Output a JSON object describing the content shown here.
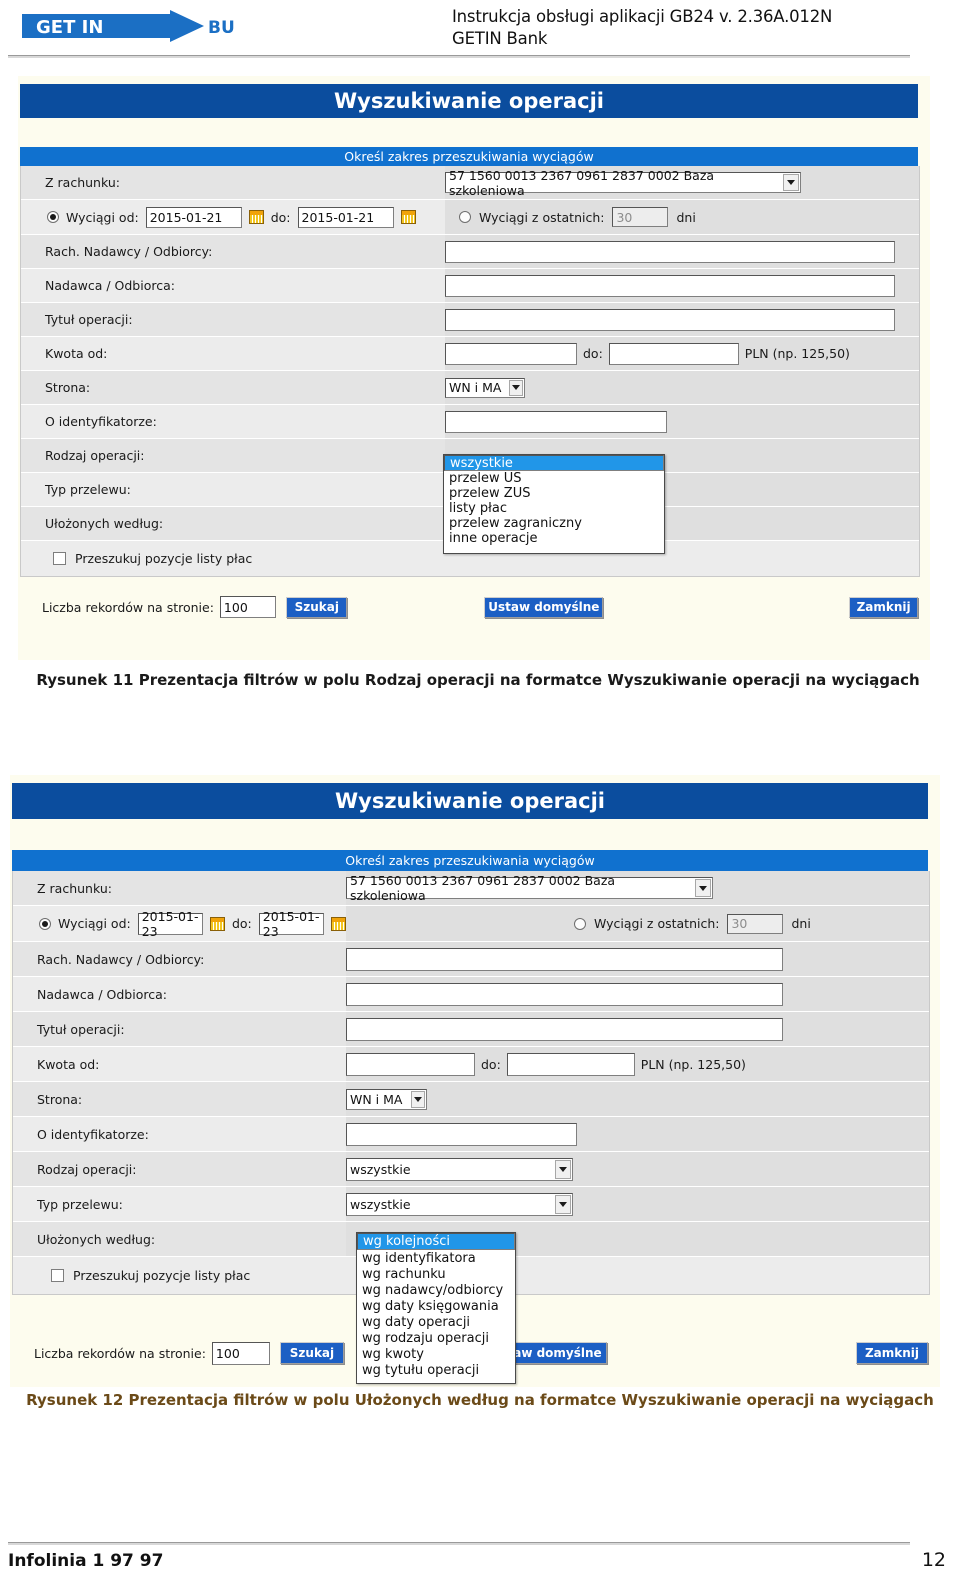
{
  "document": {
    "header_title_line1": "Instrukcja obsługi aplikacji GB24 v. 2.36A.012N",
    "header_title_line2": "GETIN Bank",
    "logo_text_white": "GET IN",
    "logo_text_blue": "BUSINESS",
    "footer_left": "Infolinia 1 97 97",
    "footer_page": "12"
  },
  "captions": {
    "figure11": "Rysunek 11 Prezentacja filtrów w polu Rodzaj operacji na formatce Wyszukiwanie operacji na wyciągach",
    "figure12": "Rysunek 12 Prezentacja filtrów w polu Ułożonych według na formatce Wyszukiwanie operacji na wyciągach"
  },
  "form": {
    "title": "Wyszukiwanie operacji",
    "section_header": "Określ zakres przeszukiwania wyciągów",
    "labels": {
      "account": "Z rachunku:",
      "statements_from": "Wyciągi od:",
      "to": "do:",
      "last_statements": "Wyciągi z ostatnich:",
      "days": "dni",
      "counterparty_account": "Rach. Nadawcy / Odbiorcy:",
      "counterparty": "Nadawca / Odbiorca:",
      "operation_title": "Tytuł operacji:",
      "amount_from": "Kwota od:",
      "amount_to": "do:",
      "currency_hint": "PLN (np. 125,50)",
      "side": "Strona:",
      "identifier": "O identyfikatorze:",
      "operation_type": "Rodzaj operacji:",
      "transfer_type": "Typ przelewu:",
      "sorted_by": "Ułożonych według:",
      "search_payroll": "Przeszukuj pozycje listy płac",
      "records_per_page": "Liczba rekordów na stronie:"
    },
    "buttons": {
      "search": "Szukaj",
      "set_default": "Ustaw domyślne",
      "close": "Zamknij"
    },
    "values": {
      "account": "57 1560 0013 2367 0961 2837 0002 Baza szkoleniowa",
      "days": "30",
      "side": "WN i MA",
      "records_per_page": "100",
      "counterparty_account": "",
      "counterparty": "",
      "operation_title": "",
      "amount_from": "",
      "amount_to": "",
      "identifier": ""
    }
  },
  "figure11": {
    "date_from": "2015-01-21",
    "date_to": "2015-01-21",
    "open_dropdown": "operation_type",
    "operation_type_options": [
      "wszystkie",
      "przelew US",
      "przelew ZUS",
      "listy płac",
      "przelew zagraniczny",
      "inne operacje"
    ],
    "operation_type_selected": "wszystkie"
  },
  "figure12": {
    "date_from": "2015-01-23",
    "date_to": "2015-01-23",
    "operation_type_value": "wszystkie",
    "transfer_type_value": "wszystkie",
    "open_dropdown": "sorted_by",
    "sorted_by_options": [
      "wg kolejności",
      "wg identyfikatora",
      "wg rachunku",
      "wg nadawcy/odbiorcy",
      "wg daty księgowania",
      "wg daty operacji",
      "wg rodzaju operacji",
      "wg kwoty",
      "wg tytułu operacji"
    ],
    "sorted_by_selected": "wg kolejności"
  },
  "colors": {
    "title_bar": "#0b4d9e",
    "section_bar": "#1071cf",
    "button": "#1c5fc4",
    "highlight": "#2196e8",
    "page_bg": "#fdfcee"
  }
}
